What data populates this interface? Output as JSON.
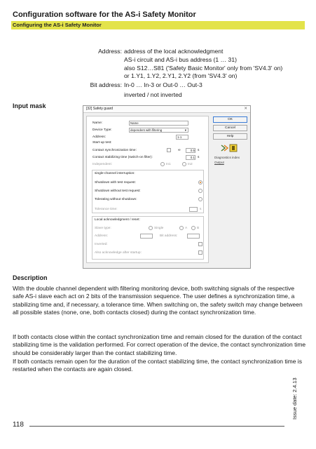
{
  "header": {
    "title": "Configuration software for the AS-i Safety Monitor",
    "subtitle": "Configuring the AS-i Safety Monitor"
  },
  "definitions": [
    {
      "key": "Address:",
      "lines": [
        "address of the local acknowledgment",
        "AS-i circuit and AS-i bus address (1 … 31)",
        "also S12…S81 ('Safety Basic Monitor' only from 'SV4.3' on)",
        "or 1.Y1, 1.Y2, 2.Y1, 2.Y2 (from 'SV4.3' on)"
      ]
    },
    {
      "key": "Bit address:",
      "lines": [
        "In-0 … In-3 or Out-0 … Out-3",
        "inverted / not inverted"
      ]
    }
  ],
  "input_mask_label": "Input mask",
  "dialog": {
    "title": "[32] Safety guard",
    "close_glyph": "✕",
    "name_label": "Name:",
    "name_value": "Name",
    "device_type_label": "Device Type:",
    "device_type_value": "dependent with filtering",
    "address_label": "Address:",
    "address_value": "1-1",
    "startup_test_label": "Start-up test:",
    "sync_time_label": "Contact synchronization time:",
    "sync_inf": "∞",
    "sync_value": "0.5",
    "stab_time_label": "Contact stabilizing time (switch-on filter):",
    "stab_value": "0.1",
    "unit_s": "s",
    "independent_label": "Independent:",
    "radio_in1": "In1",
    "radio_in2": "In2",
    "interruption_label": "single-channel interruption:",
    "shutdown_test_label": "Shutdown with test request:",
    "shutdown_notest_label": "Shutdown without test request:",
    "tolerating_label": "Tolerating without shutdown:",
    "tolerance_label": "Tolerance time:",
    "local_ack_label": "Local acknowledgment / reset:",
    "slave_type_label": "Slave type:",
    "single_label": "Single",
    "a_label": "A",
    "b_label": "B",
    "ack_address_label": "Address:",
    "bit_address_label": "Bit address:",
    "inverted_label": "Inverted:",
    "also_ack_label": "Also acknowledge after startup:",
    "buttons": {
      "ok": "OK",
      "cancel": "Cancel",
      "help": "Help"
    },
    "links": {
      "diag": "Diagnostics index",
      "output": "Output"
    },
    "colors": {
      "accent": "#e07a10",
      "ok_border": "#3a7bd5"
    }
  },
  "description_label": "Description",
  "description": [
    "With the double channel dependent with filtering monitoring device, both switching signals of the respective safe AS-i slave each act on 2 bits of the transmission sequence. The user defines a synchronization time, a stabilizing time and, if necessary, a tolerance time. When switching on, the safety switch may change between all possible states (none, one, both contacts closed) during the contact synchronization time.",
    "If both contacts close within the contact synchronization time and remain closed for the duration of the contact stabilizing time is the validation performed. For correct operation of the device, the contact synchronization time should be considerably larger than the contact stabilizing time.",
    "If both contacts remain open for the duration of the contact stabilizing time, the contact synchronization time is restarted when the contacts are again closed."
  ],
  "footer": {
    "page": "118",
    "issue": "Issue date: 2.4.13"
  },
  "colors": {
    "header_bar": "#e3e34a"
  }
}
